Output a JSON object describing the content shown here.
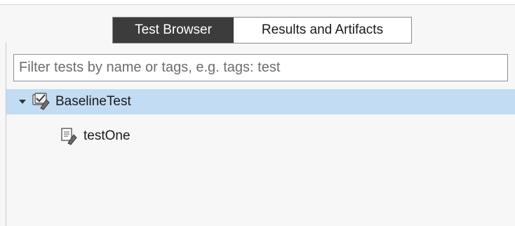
{
  "tabs": [
    {
      "label": "Test Browser",
      "active": true
    },
    {
      "label": "Results and Artifacts",
      "active": false
    }
  ],
  "filter": {
    "placeholder": "Filter tests by name or tags, e.g. tags: test",
    "value": ""
  },
  "tree": {
    "root": {
      "label": "BaselineTest",
      "expanded": true,
      "selected": true,
      "icon": "test-class-icon"
    },
    "children": [
      {
        "label": "testOne",
        "icon": "test-method-icon"
      }
    ]
  },
  "colors": {
    "active_tab": "#3c3c3c",
    "selection": "#c2dcf3"
  }
}
